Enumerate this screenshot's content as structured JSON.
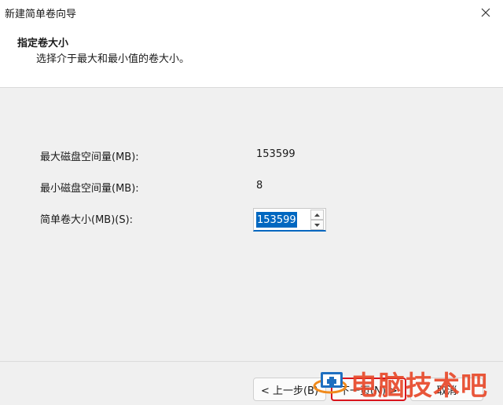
{
  "window": {
    "title": "新建简单卷向导"
  },
  "header": {
    "title": "指定卷大小",
    "subtitle": "选择介于最大和最小值的卷大小。"
  },
  "fields": {
    "max_label": "最大磁盘空间量(MB):",
    "max_value": "153599",
    "min_label": "最小磁盘空间量(MB):",
    "min_value": "8",
    "size_label": "简单卷大小(MB)(S):",
    "size_value": "153599"
  },
  "buttons": {
    "back": "< 上一步(B)",
    "next": "下一页(N) >",
    "cancel": "取消"
  },
  "watermark": {
    "text": "电脑技术吧"
  },
  "colors": {
    "accent": "#0067c0",
    "highlight_border": "#d9141c",
    "watermark": "#e8492a"
  }
}
